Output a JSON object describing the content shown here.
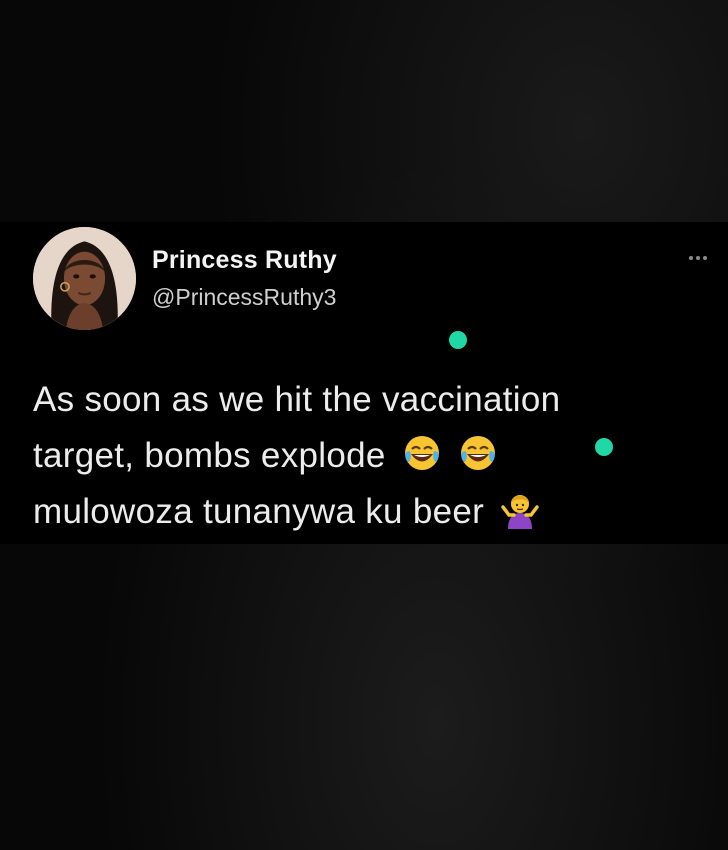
{
  "tweet": {
    "display_name": "Princess Ruthy",
    "handle": "@PrincessRuthy3",
    "lines": [
      "As soon as we hit the vaccination",
      "target, bombs explode",
      "mulowoza tunanywa ku beer"
    ],
    "emojis": {
      "line2": [
        "tears-of-joy-emoji",
        "tears-of-joy-emoji"
      ],
      "line3": [
        "person-shrugging-emoji"
      ]
    },
    "more_icon": "more-horizontal-icon",
    "dot_color": "#20d8a6"
  }
}
